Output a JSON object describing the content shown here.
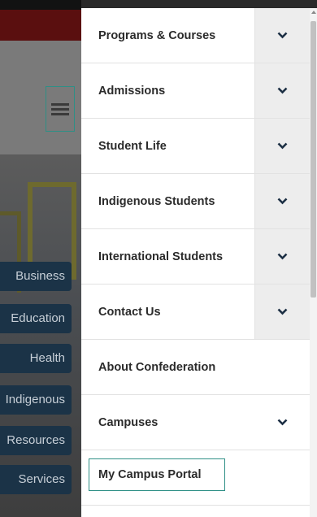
{
  "background": {
    "buttons": [
      {
        "label": "Business"
      },
      {
        "label": "Education"
      },
      {
        "label": "Health"
      },
      {
        "label": "Indigenous"
      },
      {
        "label": "Resources"
      },
      {
        "label": "Services"
      }
    ]
  },
  "menu": {
    "items": [
      {
        "label": "Programs & Courses",
        "toggle_icon": "chevron-down-icon"
      },
      {
        "label": "Admissions",
        "toggle_icon": "chevron-down-icon"
      },
      {
        "label": "Student Life",
        "toggle_icon": "chevron-down-icon"
      },
      {
        "label": "Indigenous Students",
        "toggle_icon": "chevron-down-icon"
      },
      {
        "label": "International Students",
        "toggle_icon": "chevron-down-icon"
      },
      {
        "label": "Contact Us",
        "toggle_icon": "chevron-down-icon"
      },
      {
        "label": "About Confederation"
      },
      {
        "label": "Campuses",
        "toggle_icon": "chevron-down-icon"
      }
    ],
    "portal_label": "My Campus Portal"
  },
  "colors": {
    "accent_teal": "#2e8f86",
    "chevron_navy": "#1c2f44",
    "toggle_bg": "#ededed"
  }
}
